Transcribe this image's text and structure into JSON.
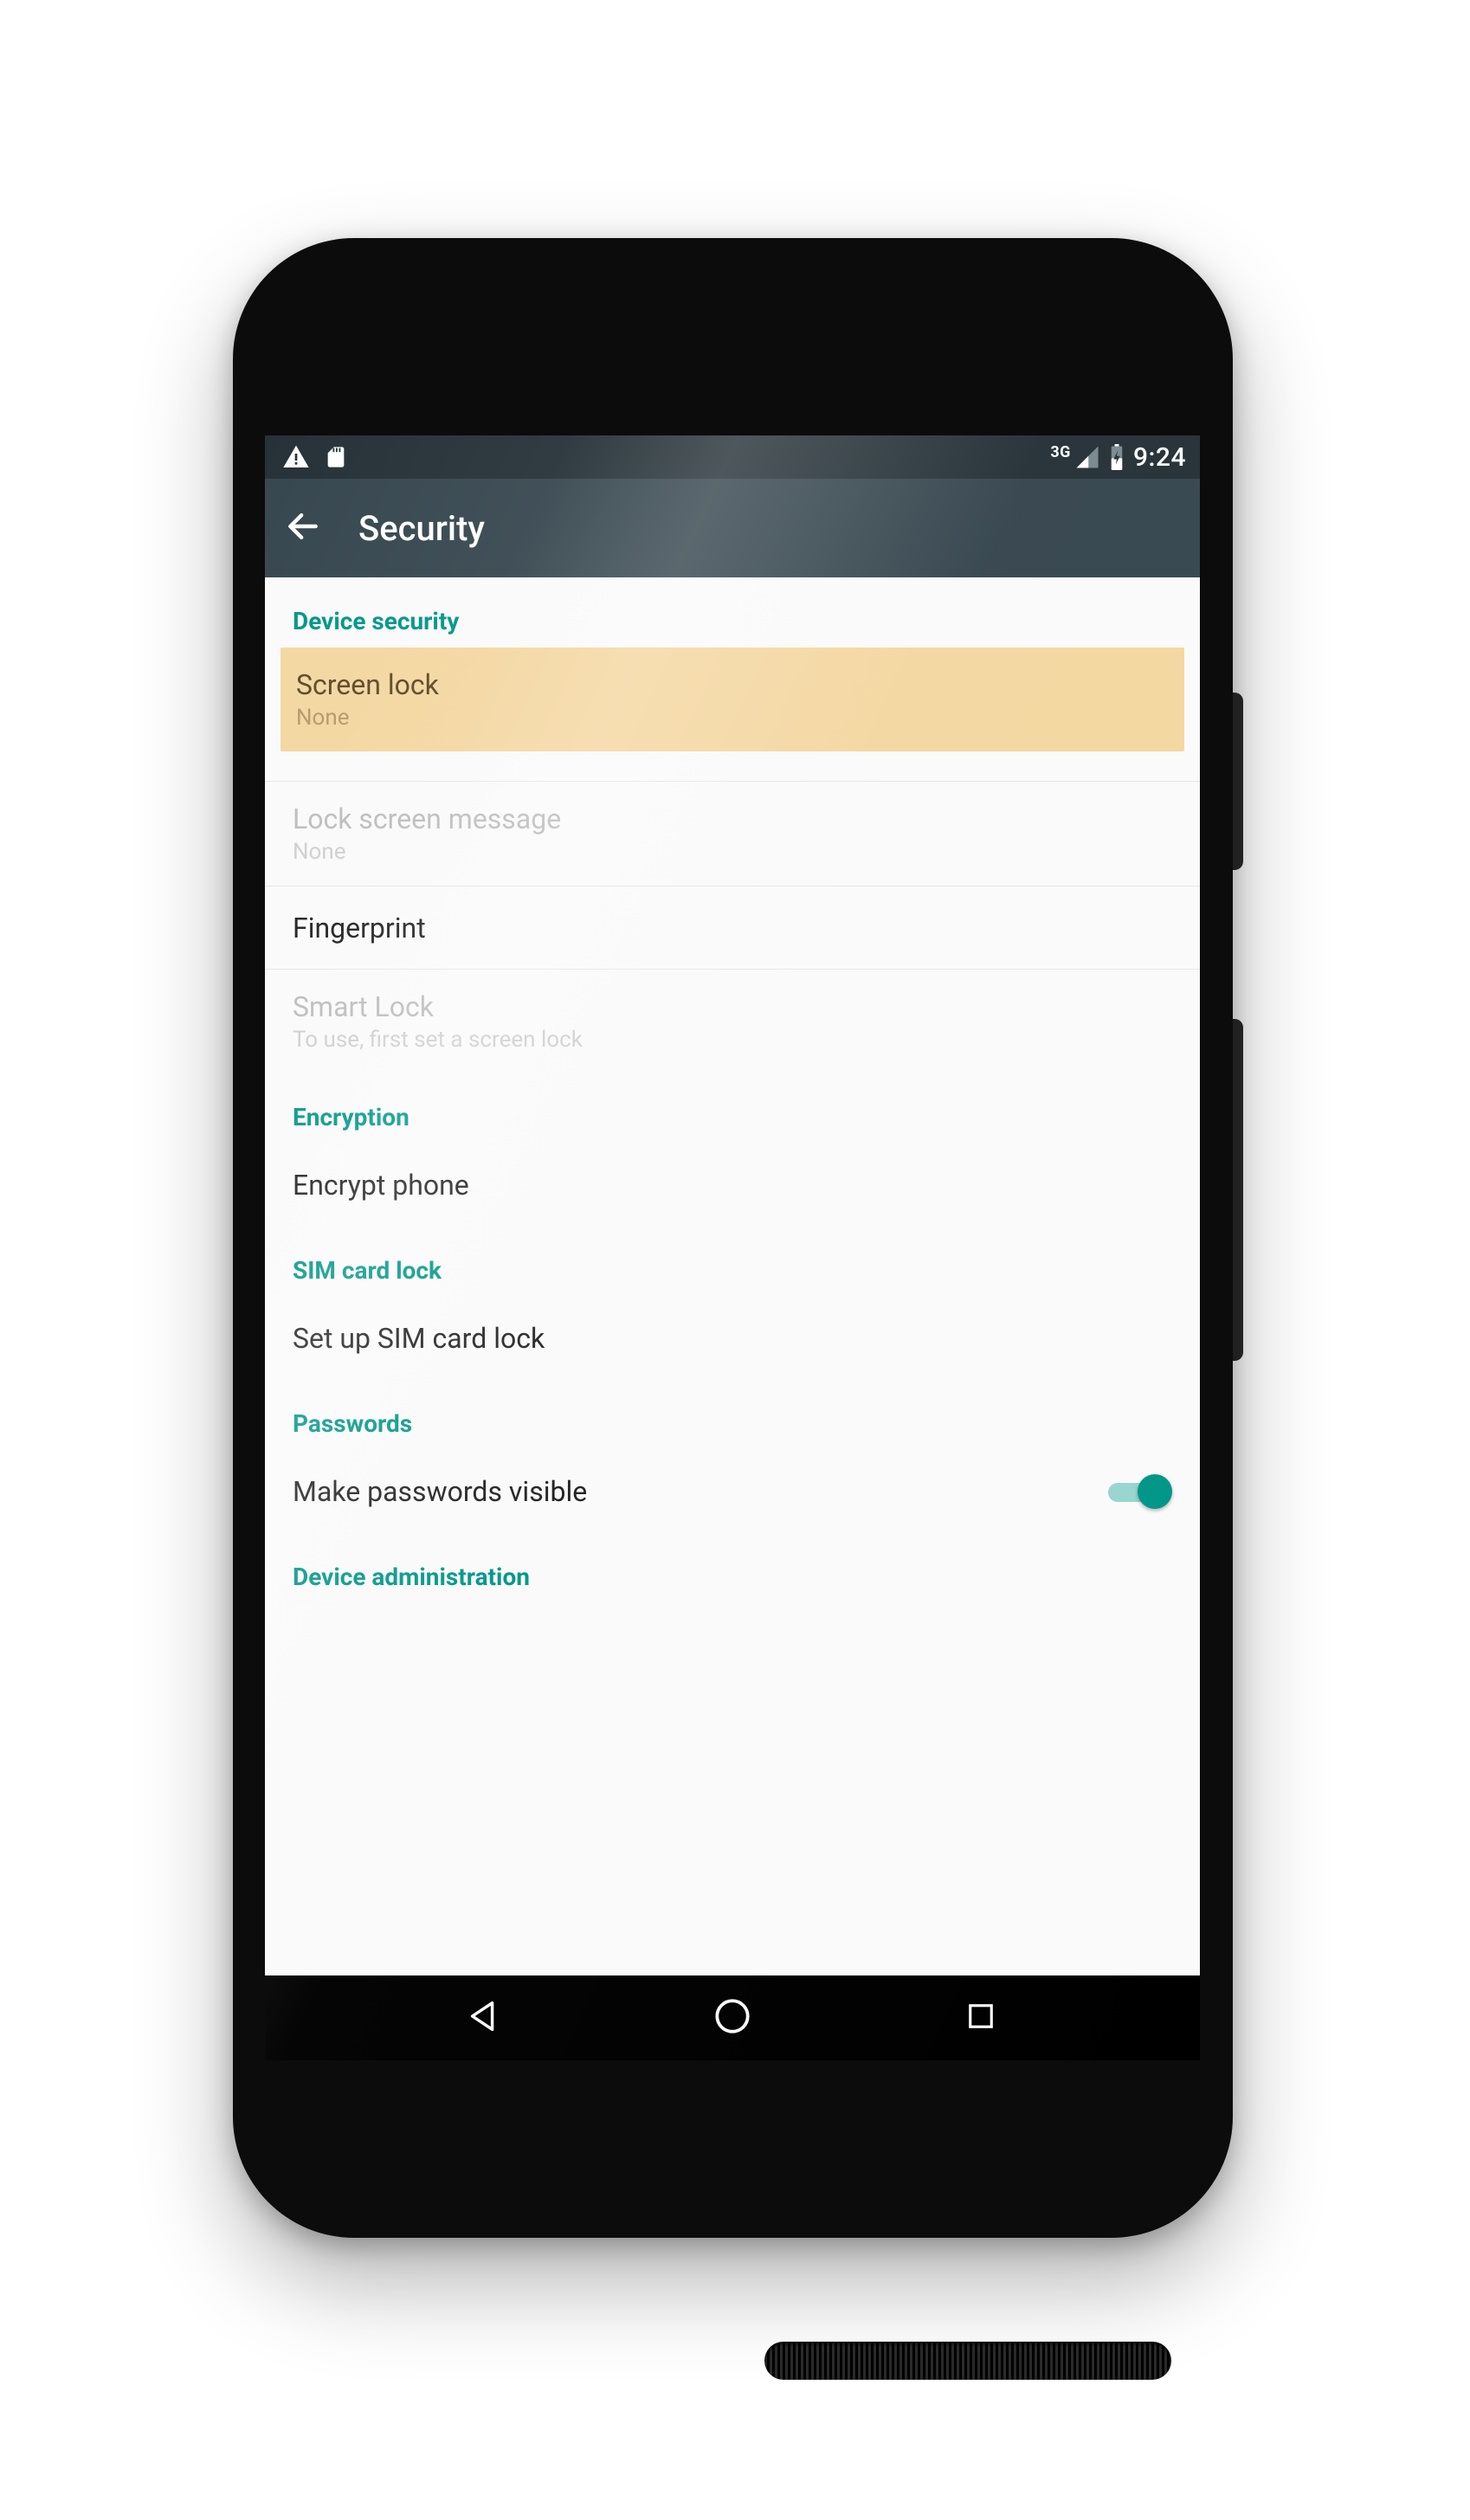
{
  "statusbar": {
    "network_label": "3G",
    "time": "9:24"
  },
  "appbar": {
    "title": "Security"
  },
  "sections": {
    "device_security": {
      "header": "Device security",
      "screen_lock": {
        "title": "Screen lock",
        "value": "None"
      },
      "lock_screen_message": {
        "title": "Lock screen message",
        "value": "None"
      },
      "fingerprint": {
        "title": "Fingerprint"
      },
      "smart_lock": {
        "title": "Smart Lock",
        "value": "To use, first set a screen lock"
      }
    },
    "encryption": {
      "header": "Encryption",
      "encrypt_phone": {
        "title": "Encrypt phone"
      }
    },
    "sim_card_lock": {
      "header": "SIM card lock",
      "setup_sim_lock": {
        "title": "Set up SIM card lock"
      }
    },
    "passwords": {
      "header": "Passwords",
      "make_visible": {
        "title": "Make passwords visible",
        "enabled": true
      }
    },
    "device_administration": {
      "header": "Device administration"
    }
  },
  "colors": {
    "accent": "#009688",
    "appbar": "#37474f",
    "statusbar": "#263238",
    "highlight": "#f4d7a1"
  }
}
